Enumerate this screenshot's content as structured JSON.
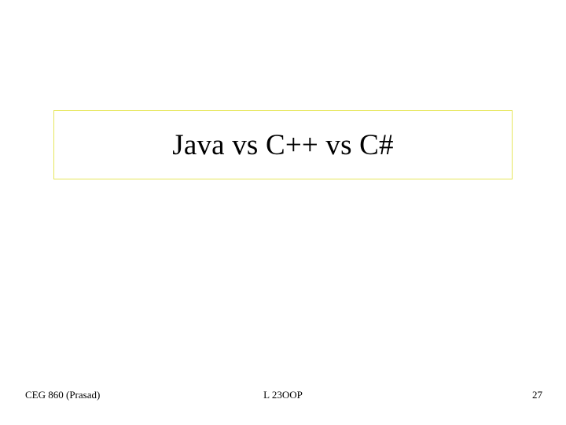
{
  "slide": {
    "title": "Java vs C++ vs C#"
  },
  "footer": {
    "left": "CEG 860  (Prasad)",
    "center": "L 23OOP",
    "right": "27"
  }
}
